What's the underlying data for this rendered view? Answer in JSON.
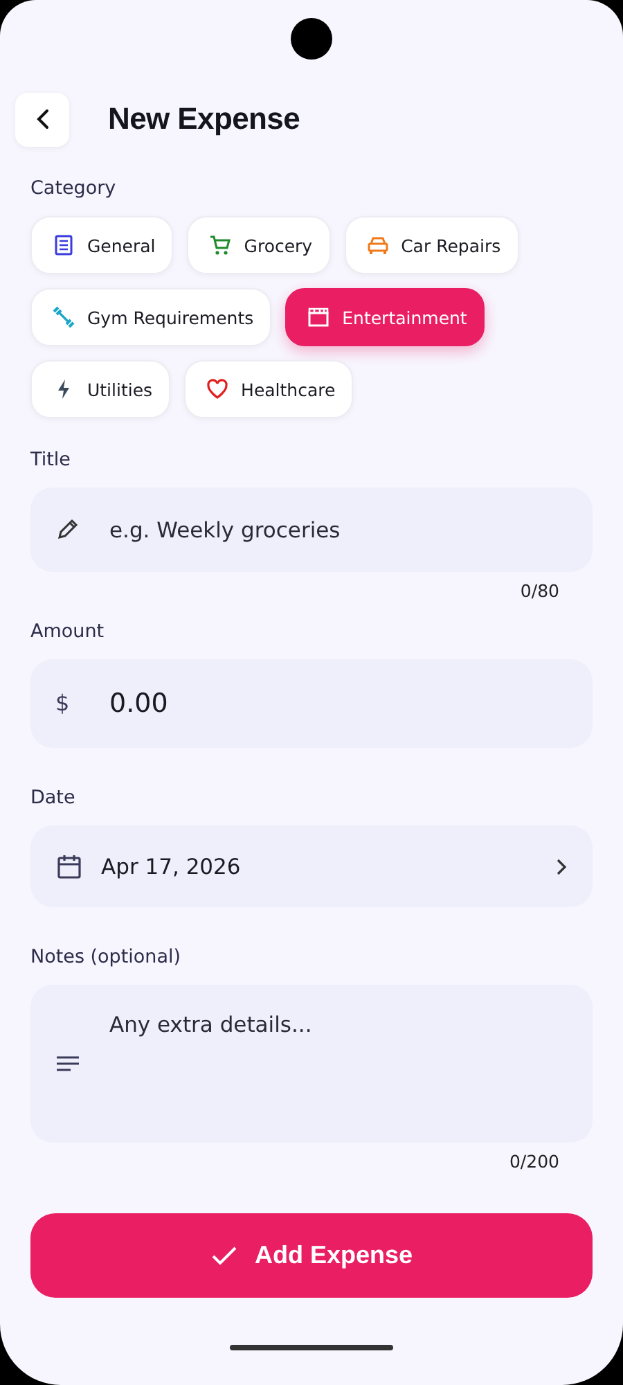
{
  "header": {
    "title": "New Expense"
  },
  "category": {
    "label": "Category",
    "items": [
      {
        "label": "General",
        "kind": "general",
        "color": "#3b3be0",
        "selected": false
      },
      {
        "label": "Grocery",
        "kind": "grocery",
        "color": "#1f8a2a",
        "selected": false
      },
      {
        "label": "Car Repairs",
        "kind": "car",
        "color": "#f07a1a",
        "selected": false
      },
      {
        "label": "Gym Requirements",
        "kind": "gym",
        "color": "#1aa6c8",
        "selected": false
      },
      {
        "label": "Entertainment",
        "kind": "entertainment",
        "color": "#ffffff",
        "selected": true
      },
      {
        "label": "Utilities",
        "kind": "utilities",
        "color": "#3b4a5a",
        "selected": false
      },
      {
        "label": "Healthcare",
        "kind": "healthcare",
        "color": "#e0201e",
        "selected": false
      }
    ]
  },
  "title_field": {
    "label": "Title",
    "placeholder": "e.g. Weekly groceries",
    "counter": "0/80"
  },
  "amount_field": {
    "label": "Amount",
    "currency": "$",
    "value": "0.00"
  },
  "date_field": {
    "label": "Date",
    "value": "Apr 17, 2026"
  },
  "notes_field": {
    "label": "Notes (optional)",
    "placeholder": "Any extra details...",
    "counter": "0/200"
  },
  "submit_button": {
    "label": "Add Expense"
  }
}
